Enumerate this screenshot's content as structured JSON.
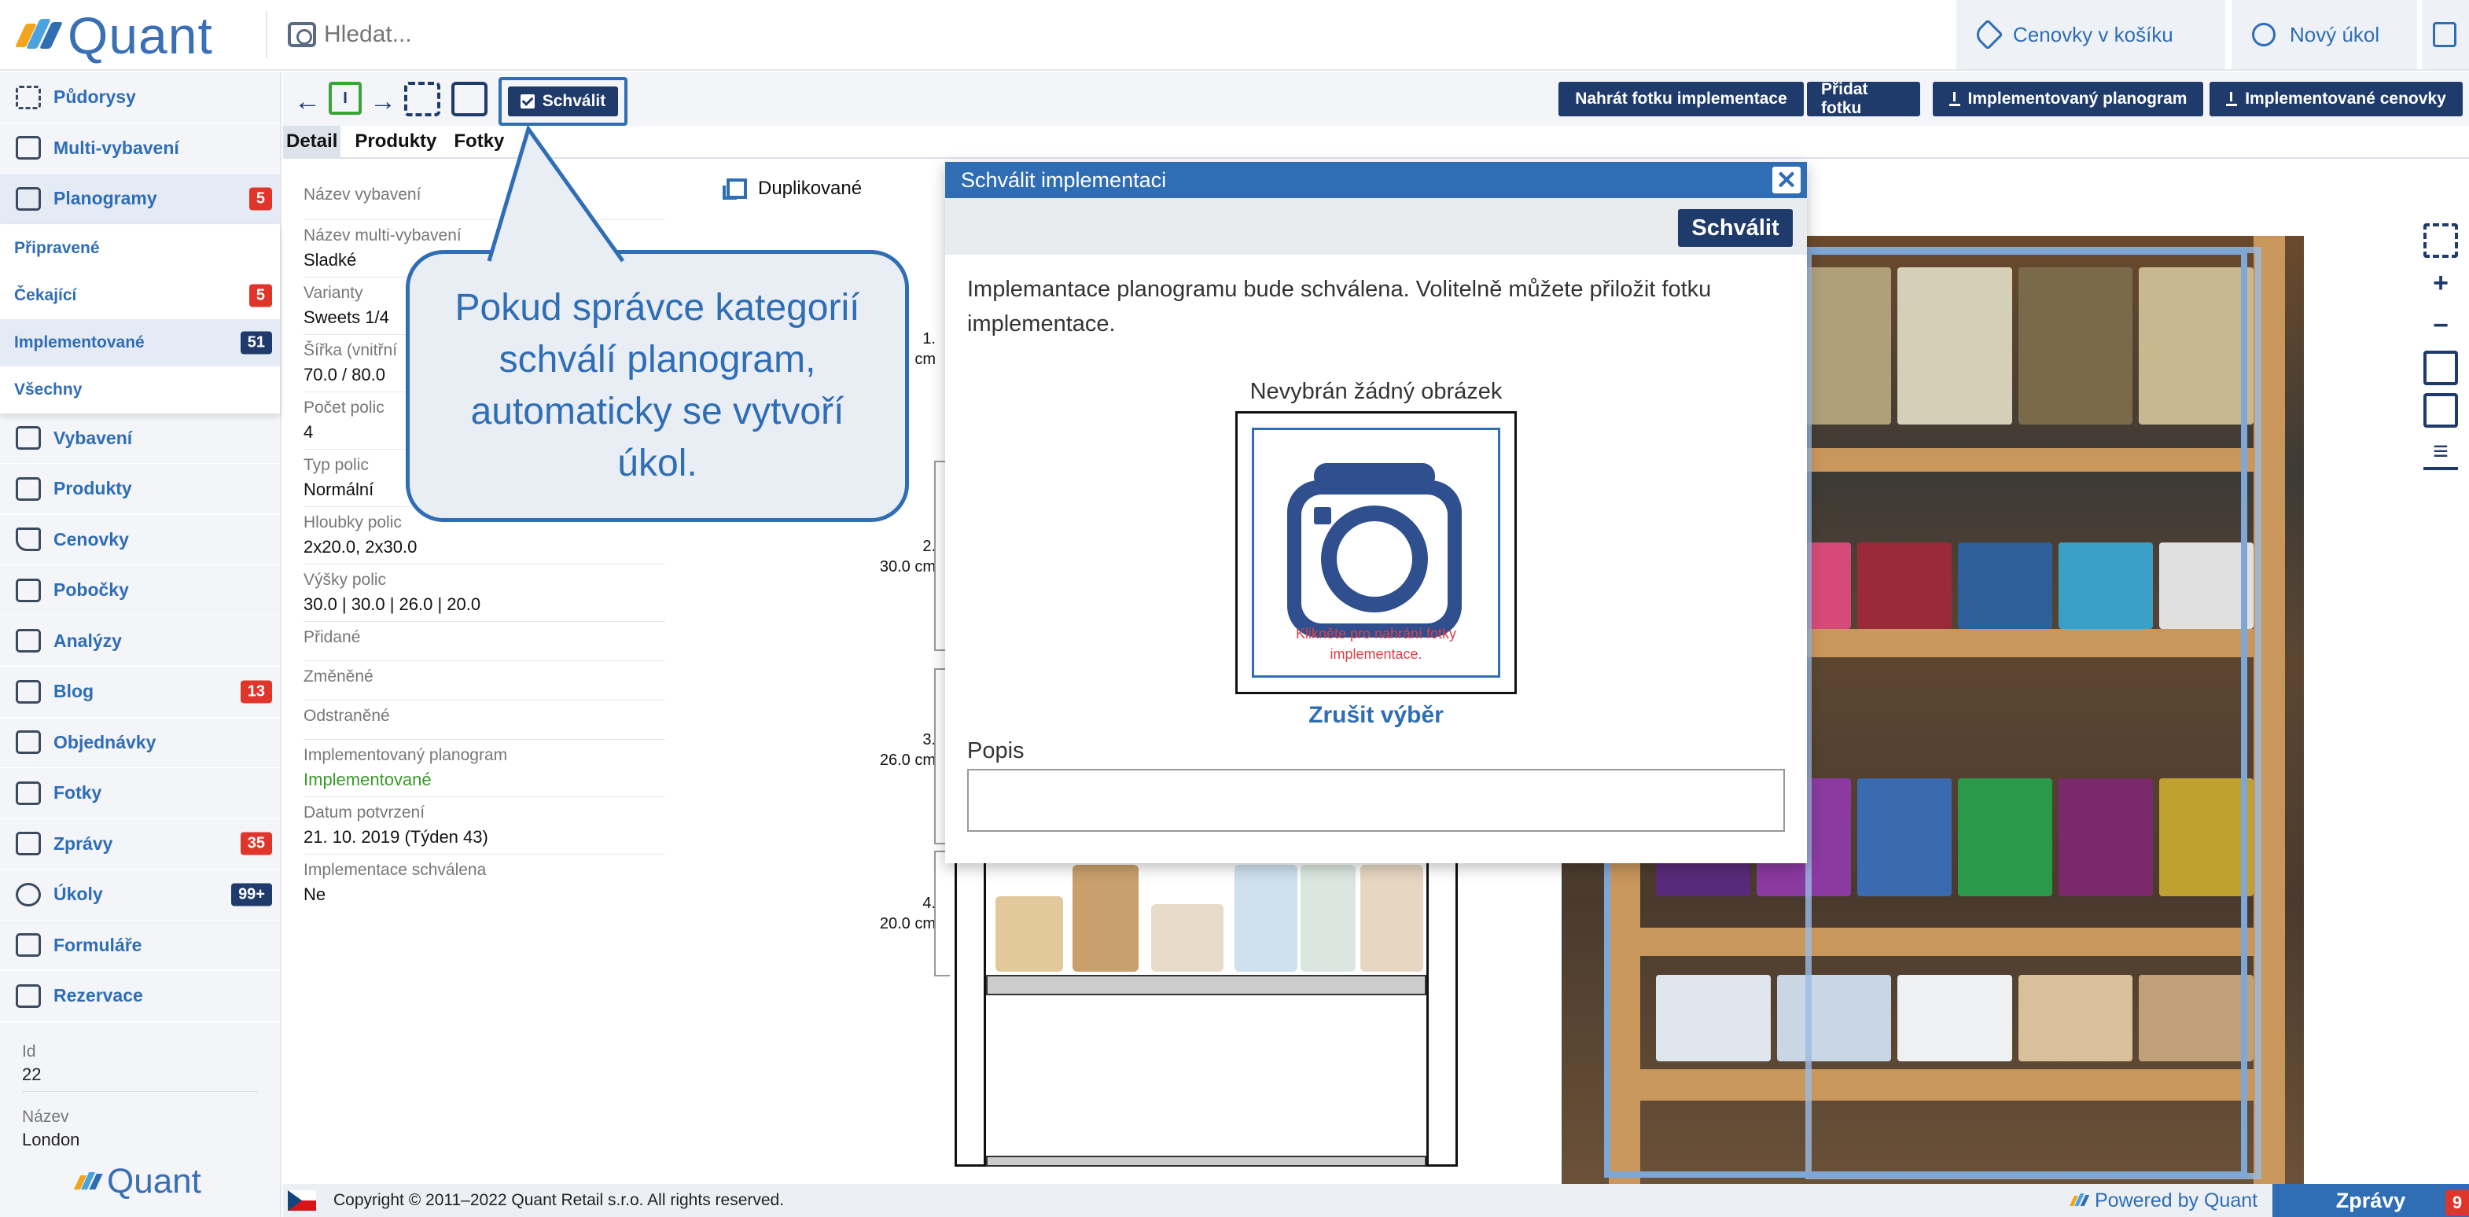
{
  "header": {
    "logo_text": "Quant",
    "search_placeholder": "Hledat...",
    "cart_label": "Cenovky v košíku",
    "new_task_label": "Nový úkol"
  },
  "sidebar": {
    "items": [
      {
        "label": "Půdorysy",
        "icon": "floorplan-icon"
      },
      {
        "label": "Multi-vybavení",
        "icon": "multi-equipment-icon"
      },
      {
        "label": "Planogramy",
        "icon": "planogram-icon",
        "badge": "5"
      }
    ],
    "sub_items": [
      {
        "label": "Připravené"
      },
      {
        "label": "Čekající",
        "badge": "5"
      },
      {
        "label": "Implementované",
        "badge": "51"
      },
      {
        "label": "Všechny"
      }
    ],
    "items2": [
      {
        "label": "Vybavení",
        "icon": "equipment-icon"
      },
      {
        "label": "Produkty",
        "icon": "products-icon"
      },
      {
        "label": "Cenovky",
        "icon": "price-tag-icon"
      },
      {
        "label": "Pobočky",
        "icon": "store-icon"
      },
      {
        "label": "Analýzy",
        "icon": "analytics-icon"
      },
      {
        "label": "Blog",
        "icon": "blog-icon",
        "badge": "13"
      },
      {
        "label": "Objednávky",
        "icon": "orders-icon"
      },
      {
        "label": "Fotky",
        "icon": "photos-icon"
      },
      {
        "label": "Zprávy",
        "icon": "messages-icon",
        "badge": "35"
      },
      {
        "label": "Úkoly",
        "icon": "tasks-icon",
        "badge": "99+"
      },
      {
        "label": "Formuláře",
        "icon": "forms-icon"
      },
      {
        "label": "Rezervace",
        "icon": "reservation-icon"
      }
    ],
    "info": {
      "id_label": "Id",
      "id_value": "22",
      "name_label": "Název",
      "name_value": "London"
    },
    "footer_logo": "Quant"
  },
  "toolbar": {
    "approve_label": "Schválit",
    "upload_impl_photo": "Nahrát fotku implementace",
    "add_photo": "Přidat fotku",
    "impl_planogram": "Implementovaný planogram",
    "impl_price_tags": "Implementované cenovky"
  },
  "tabs": [
    "Detail",
    "Produkty",
    "Fotky"
  ],
  "detail": {
    "fields": [
      {
        "label": "Název vybavení",
        "value": ""
      },
      {
        "label": "Název multi-vybavení",
        "value": "Sladké"
      },
      {
        "label": "Varianty",
        "value": "Sweets 1/4"
      },
      {
        "label": "Šířka (vnitřní",
        "value": "70.0 / 80.0"
      },
      {
        "label": "Počet polic",
        "value": "4"
      },
      {
        "label": "Typ polic",
        "value": "Normální"
      },
      {
        "label": "Hloubky polic",
        "value": "2x20.0, 2x30.0"
      },
      {
        "label": "Výšky polic",
        "value": "30.0 | 30.0 | 26.0 | 20.0"
      },
      {
        "label": "Přidané",
        "value": ""
      },
      {
        "label": "Změněné",
        "value": ""
      },
      {
        "label": "Odstraněné",
        "value": ""
      },
      {
        "label": "Implementovaný planogram",
        "value": "Implementované"
      },
      {
        "label": "Datum potvrzení",
        "value": "21. 10. 2019 (Týden 43)"
      },
      {
        "label": "Implementace schválena",
        "value": "Ne"
      }
    ]
  },
  "duplicated_label": "Duplikované",
  "shelves": [
    {
      "num": "1.",
      "height": "cm"
    },
    {
      "num": "2.",
      "height": "30.0 cm"
    },
    {
      "num": "3.",
      "height": "26.0 cm"
    },
    {
      "num": "4.",
      "height": "20.0 cm"
    }
  ],
  "callout": {
    "text": "Pokud správce kategorií schválí planogram, automaticky se vytvoří úkol."
  },
  "modal": {
    "title": "Schválit implementaci",
    "close": "✕",
    "approve_label": "Schválit",
    "description": "Implemantace planogramu bude schválena. Volitelně můžete přiložit fotku implementace.",
    "no_image": "Nevybrán žádný obrázek",
    "upload_hint": "Klikněte pro nahrání fotky implementace.",
    "cancel_selection": "Zrušit výběr",
    "popis_label": "Popis"
  },
  "footer": {
    "copyright": "Copyright © 2011–2022 Quant Retail s.r.o. All rights reserved.",
    "powered": "Powered by Quant",
    "messages": "Zprávy",
    "messages_count": "9"
  },
  "colors": {
    "accent": "#2f6db5",
    "dark": "#1f3b6b",
    "badge_red": "#e0352b",
    "green": "#3a9a2a"
  }
}
